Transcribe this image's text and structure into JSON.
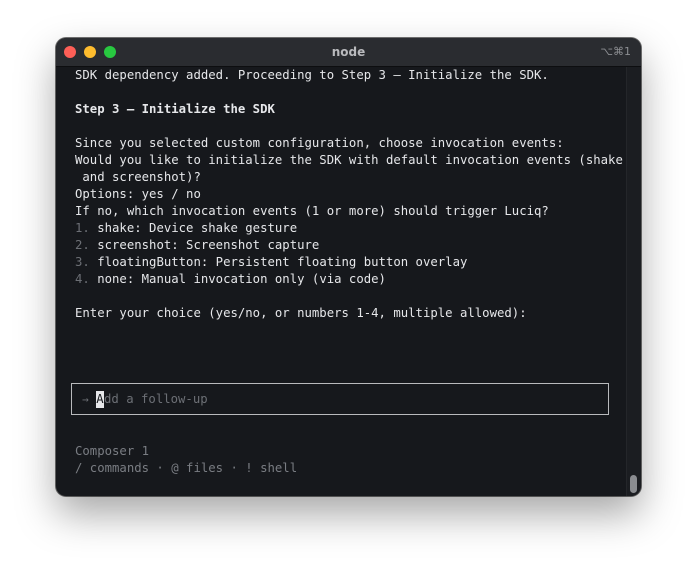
{
  "window": {
    "title": "node",
    "shortcut": "⌥⌘1"
  },
  "terminal": {
    "lines": {
      "l1": "SDK dependency added. Proceeding to Step 3 — Initialize the SDK.",
      "l2": "Step 3 — Initialize the SDK",
      "l3": "Since you selected custom configuration, choose invocation events:",
      "l4": "Would you like to initialize the SDK with default invocation events (shake",
      "l5": " and screenshot)?",
      "l6": "Options: yes / no",
      "l7": "If no, which invocation events (1 or more) should trigger Luciq?",
      "l8": "Enter your choice (yes/no, or numbers 1-4, multiple allowed):"
    },
    "options": [
      {
        "num": "1.",
        "text": " shake: Device shake gesture"
      },
      {
        "num": "2.",
        "text": " screenshot: Screenshot capture"
      },
      {
        "num": "3.",
        "text": " floatingButton: Persistent floating button overlay"
      },
      {
        "num": "4.",
        "text": " none: Manual invocation only (via code)"
      }
    ]
  },
  "composer": {
    "arrow": "→",
    "cursor_char": "A",
    "placeholder_rest": "dd a follow-up",
    "model": "Composer 1",
    "hints": "/ commands · @ files · ! shell"
  },
  "colors": {
    "background": "#16181c",
    "text": "#e6e7ea",
    "muted": "#6c6f75"
  }
}
